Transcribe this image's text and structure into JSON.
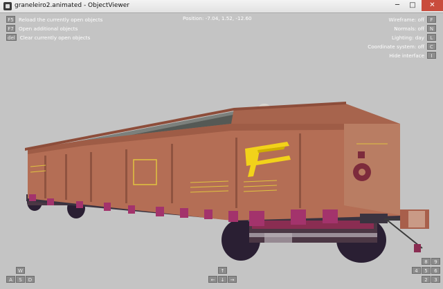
{
  "window": {
    "title": "graneleiro2.animated - ObjectViewer",
    "minimize_glyph": "─",
    "maximize_glyph": "□",
    "close_glyph": "✕"
  },
  "hud": {
    "left": [
      {
        "key": "F5",
        "label": "Reload the currently open objects"
      },
      {
        "key": "F7",
        "label": "Open additional objects"
      },
      {
        "key": "del",
        "label": "Clear currently open objects"
      }
    ],
    "position_text": "Position: -7.04, 1.52, -12.60",
    "right": [
      {
        "label": "Wireframe: off",
        "key": "F"
      },
      {
        "label": "Normals: off",
        "key": "N"
      },
      {
        "label": "Lighting: day",
        "key": "L"
      },
      {
        "label": "Coordinate system: off",
        "key": "C"
      },
      {
        "label": "Hide interface",
        "key": "I"
      }
    ]
  },
  "controls": {
    "bottom_left": {
      "w": "W",
      "a": "A",
      "s": "S",
      "d": "D"
    },
    "bottom_center": {
      "up": "↑",
      "left": "←",
      "down": "↓",
      "right": "→"
    },
    "bottom_right": [
      "8",
      "9",
      "4",
      "5",
      "6",
      "2",
      "3"
    ]
  },
  "wagon": {
    "body_color": "#b46e55",
    "logo_color": "#f2d21a",
    "lettering_color": "#e0c440"
  }
}
